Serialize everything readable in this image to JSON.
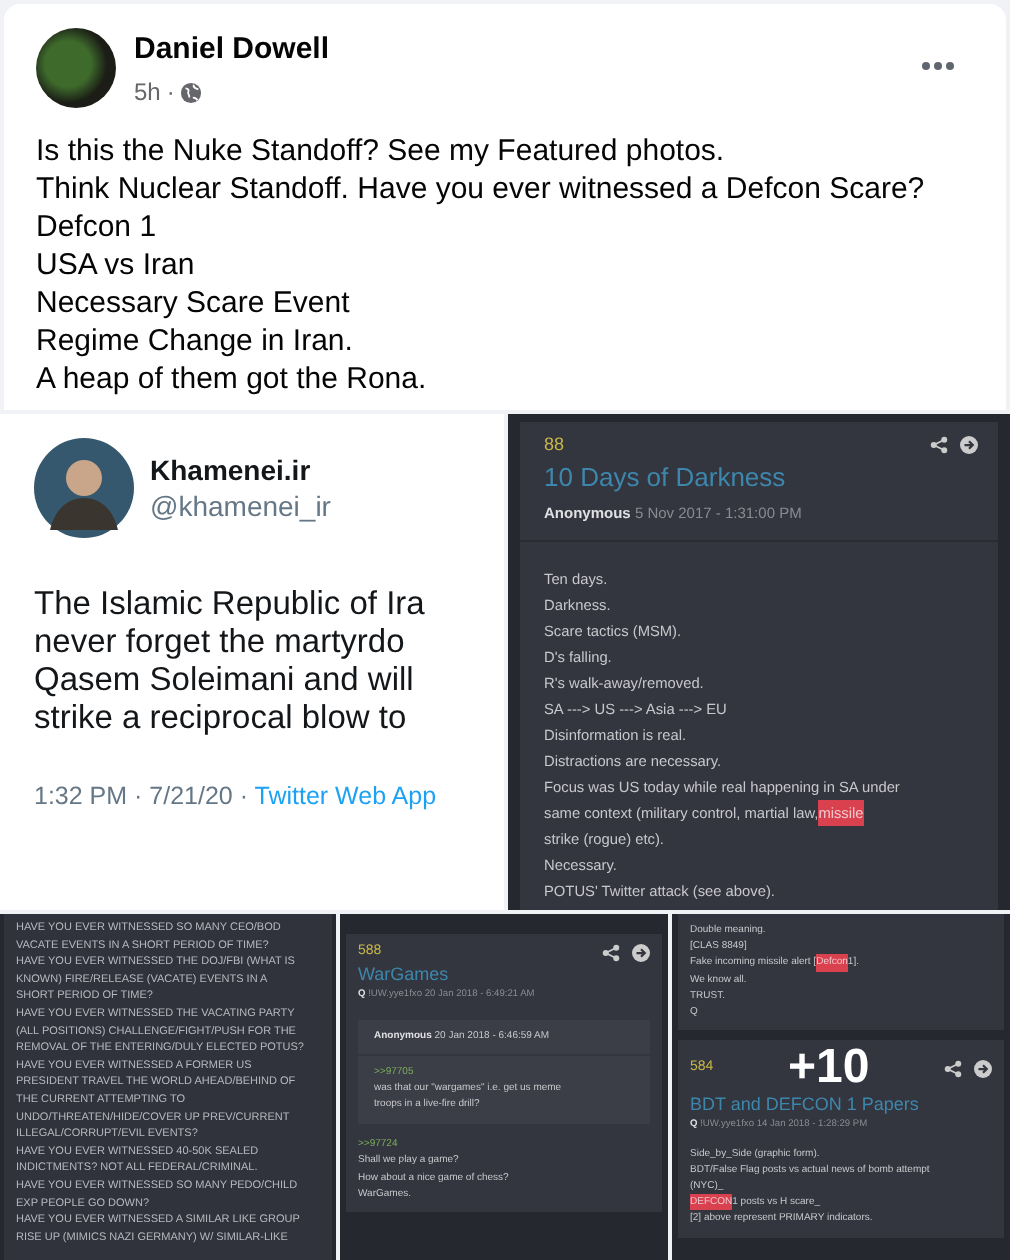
{
  "post": {
    "author": "Daniel Dowell",
    "time": "5h",
    "separator": "·",
    "lines": [
      "Is this the Nuke Standoff? See my Featured photos.",
      "Think Nuclear Standoff. Have you ever witnessed a Defcon Scare?",
      "Defcon 1",
      "USA vs Iran",
      "Necessary Scare Event",
      "Regime Change in Iran.",
      "A heap of them got the Rona."
    ]
  },
  "tweet": {
    "name": "Khamenei.ir",
    "handle": "@khamenei_ir",
    "lines": [
      "The Islamic Republic of Ira",
      "never forget the martyrdo",
      "Qasem Soleimani and will",
      "strike a reciprocal blow to"
    ],
    "time": "1:32 PM · 7/21/20 ·",
    "source": "Twitter Web App"
  },
  "darkness_post": {
    "number": "88",
    "title": "10 Days of Darkness",
    "author": "Anonymous",
    "date": "5 Nov 2017 - 1:31:00 PM",
    "lines": [
      "Ten days.",
      "Darkness.",
      "Scare tactics (MSM).",
      "D's falling.",
      "R's walk-away/removed.",
      "SA ---> US ---> Asia ---> EU",
      "Disinformation is real.",
      "Distractions are necessary.",
      "Focus was US today while real happening in SA under",
      {
        "before": "same context (military control, martial law, ",
        "highlight": "missile"
      },
      "strike (rogue) etc).",
      "Necessary.",
      "POTUS' Twitter attack (see above)."
    ]
  },
  "questions_post": {
    "lines": [
      "HAVE YOU EVER WITNESSED SO MANY CEO/BOD",
      "VACATE EVENTS IN A SHORT PERIOD OF TIME?",
      "HAVE YOU EVER WITNESSED THE DOJ/FBI (WHAT IS",
      "KNOWN) FIRE/RELEASE (VACATE) EVENTS IN A",
      "SHORT PERIOD OF TIME?",
      "HAVE YOU EVER WITNESSED THE VACATING PARTY",
      "(ALL POSITIONS) CHALLENGE/FIGHT/PUSH FOR THE",
      "REMOVAL OF THE ENTERING/DULY ELECTED POTUS?",
      "HAVE YOU EVER WITNESSED A FORMER US",
      "PRESIDENT TRAVEL THE WORLD AHEAD/BEHIND OF",
      "THE CURRENT ATTEMPTING TO",
      "UNDO/THREATEN/HIDE/COVER UP PREV/CURRENT",
      "ILLEGAL/CORRUPT/EVIL EVENTS?",
      "HAVE YOU EVER WITNESSED 40-50K SEALED",
      "INDICTMENTS? NOT ALL FEDERAL/CRIMINAL.",
      "HAVE YOU EVER WITNESSED SO MANY PEDO/CHILD",
      "EXP PEOPLE GO DOWN?",
      "HAVE YOU EVER WITNESSED A SIMILAR LIKE GROUP",
      "RISE UP (MIMICS NAZI GERMANY) W/ SIMILAR-LIKE"
    ]
  },
  "wargames_post": {
    "number": "588",
    "title": "WarGames",
    "author": "Q",
    "tripcode": "!UW.yye1fxo",
    "date": "20 Jan 2018 - 6:49:21 AM",
    "quote": {
      "author": "Anonymous",
      "date": "20 Jan 2018 - 6:46:59 AM",
      "reference": ">>97705",
      "lines": [
        "was that our \"wargames\" i.e. get us meme",
        "troops in a live-fire drill?"
      ]
    },
    "reference": ">>97724",
    "lines": [
      "Shall we play a game?",
      "How about a nice game of chess?",
      "WarGames."
    ]
  },
  "defcon_post": {
    "lines": [
      "Double meaning.",
      "[CLAS 8849]",
      {
        "before": "Fake incoming missile alert [",
        "highlight": "Defcon",
        "after": " 1]."
      },
      "We know all.",
      "TRUST.",
      "Q"
    ],
    "number": "584",
    "title": "BDT and DEFCON 1 Papers",
    "author": "Q",
    "tripcode": "!UW.yye1fxo",
    "date": "14 Jan 2018 - 1:28:29 PM",
    "body": [
      "Side_by_Side (graphic form).",
      "BDT/False Flag posts vs actual news of bomb attempt",
      "(NYC)_",
      {
        "highlight": "DEFCON",
        "after": " 1 posts vs H scare_"
      },
      "[2] above represent PRIMARY indicators."
    ],
    "more_count": "+10"
  }
}
